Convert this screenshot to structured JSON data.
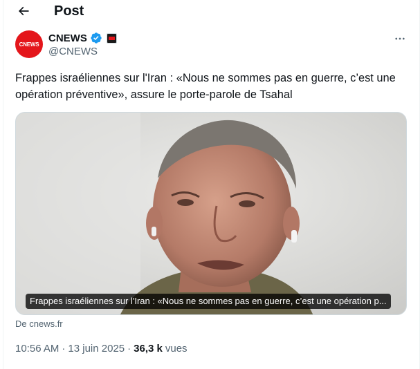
{
  "header": {
    "title": "Post"
  },
  "author": {
    "avatar_text_c": "C",
    "avatar_text_news": "NEWS",
    "name": "CNEWS",
    "handle": "@CNEWS"
  },
  "tweet": {
    "text": "Frappes israéliennes sur l'Iran : «Nous ne sommes pas en guerre, c’est une opération préventive», assure le porte-parole de Tsahal",
    "media_caption": "Frappes israéliennes sur l'Iran : «Nous ne sommes pas en guerre, c’est une opération p...",
    "source_link": "De cnews.fr"
  },
  "meta": {
    "time": "10:56 AM",
    "separator": "·",
    "date": "13 juin 2025",
    "views_count": "36,3 k",
    "views_label": "vues"
  },
  "icons": {
    "back": "arrow-left-icon",
    "verified": "verified-badge-icon",
    "affiliate": "affiliate-badge-icon",
    "more": "more-dots-icon"
  },
  "colors": {
    "verified_blue": "#1d9bf0",
    "brand_red": "#e4161b",
    "secondary_text": "#536471"
  }
}
